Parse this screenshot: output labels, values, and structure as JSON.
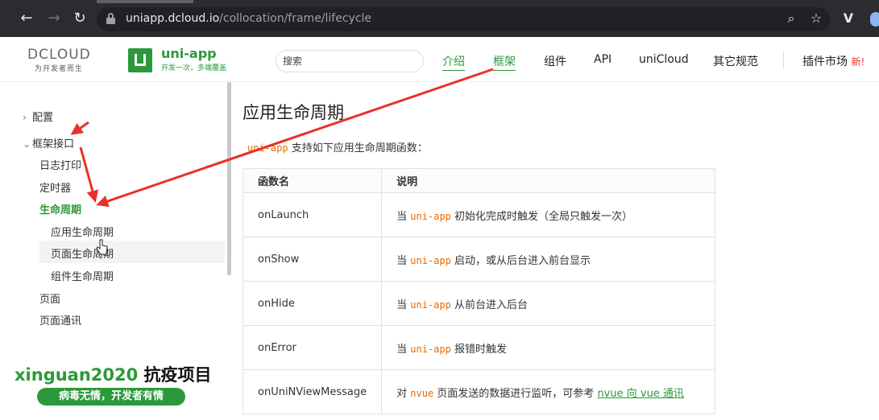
{
  "browser": {
    "url_host": "uniapp.dcloud.io",
    "url_path": "/collocation/frame/lifecycle"
  },
  "header": {
    "dcloud_logo": "DCLOUD",
    "dcloud_tagline": "为开发者而生",
    "uni_title": "uni-app",
    "uni_subtitle": "开发一次，多端覆盖",
    "search_placeholder": "搜索",
    "nav": [
      "介绍",
      "框架",
      "组件",
      "API",
      "uniCloud",
      "其它规范"
    ],
    "plugin_market": "插件市场",
    "new_badge": "新!"
  },
  "sidebar": {
    "items": [
      "配置",
      "框架接口",
      "日志打印",
      "定时器",
      "生命周期",
      "应用生命周期",
      "页面生命周期",
      "组件生命周期",
      "页面",
      "页面通讯"
    ],
    "promo_title_a": "xinguan2020",
    "promo_title_b": " 抗疫项目",
    "promo_button": "病毒无情，开发者有情"
  },
  "main": {
    "title": "应用生命周期",
    "intro_code": "uni-app",
    "intro_text": " 支持如下应用生命周期函数：",
    "table": {
      "headers": [
        "函数名",
        "说明"
      ],
      "rows": [
        {
          "name": "onLaunch",
          "pre": "当 ",
          "code": "uni-app",
          "post": " 初始化完成时触发（全局只触发一次）"
        },
        {
          "name": "onShow",
          "pre": "当 ",
          "code": "uni-app",
          "post": " 启动，或从后台进入前台显示"
        },
        {
          "name": "onHide",
          "pre": "当 ",
          "code": "uni-app",
          "post": " 从前台进入后台"
        },
        {
          "name": "onError",
          "pre": "当 ",
          "code": "uni-app",
          "post": " 报错时触发"
        },
        {
          "name": "onUniNViewMessage",
          "pre": "对 ",
          "code": "nvue",
          "post": " 页面发送的数据进行监听，可参考 ",
          "link": "nvue 向 vue 通讯"
        }
      ]
    }
  },
  "colors": {
    "brand_green": "#2b9939",
    "code_orange": "#e96900",
    "annotation_red": "#e8312a"
  }
}
